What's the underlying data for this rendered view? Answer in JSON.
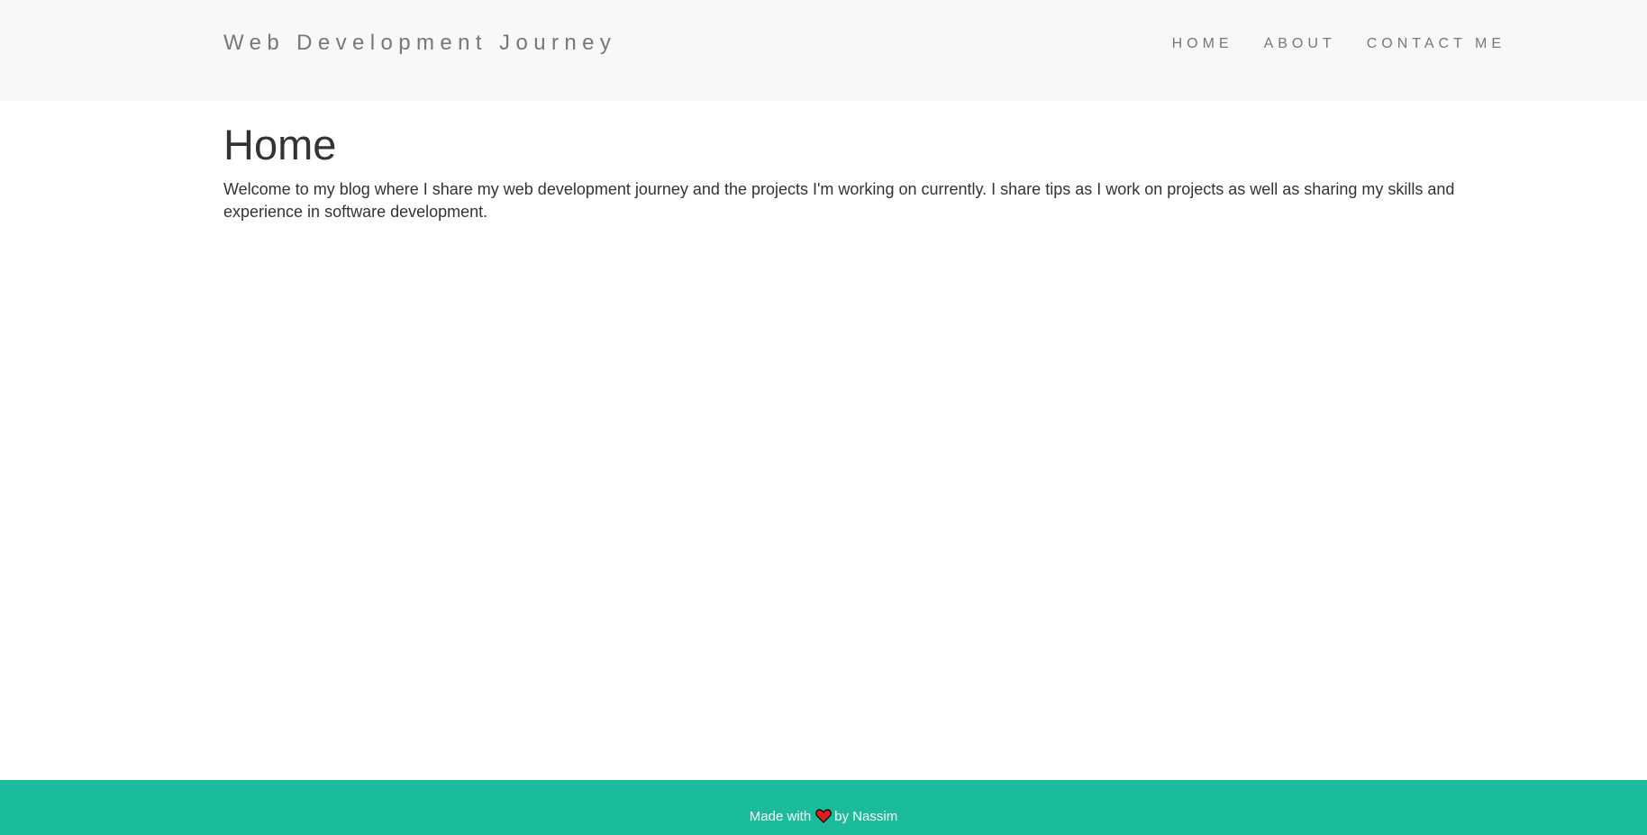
{
  "header": {
    "brand": "Web Development Journey",
    "nav": [
      "HOME",
      "ABOUT",
      "CONTACT ME"
    ]
  },
  "main": {
    "title": "Home",
    "intro": "Welcome to my blog where I share my web development journey and the projects I'm working on currently. I share tips as I work on projects as well as sharing my skills and experience in software development."
  },
  "footer": {
    "made_with": "Made with",
    "icon": "heart-icon",
    "by": "by Nassim"
  },
  "colors": {
    "navbar_bg": "#f8f8f8",
    "nav_text": "#777777",
    "body_text": "#333333",
    "footer_bg": "#1abc9c",
    "heart": "#e31b23"
  }
}
